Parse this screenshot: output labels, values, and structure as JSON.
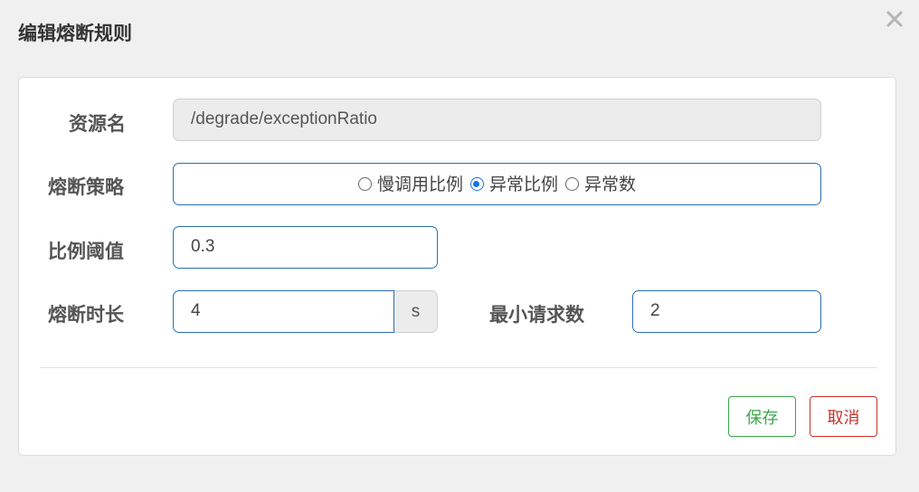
{
  "dialog": {
    "title": "编辑熔断规则"
  },
  "form": {
    "resource_label": "资源名",
    "resource_value": "/degrade/exceptionRatio",
    "strategy_label": "熔断策略",
    "strategy_options": [
      {
        "label": "慢调用比例",
        "checked": false
      },
      {
        "label": "异常比例",
        "checked": true
      },
      {
        "label": "异常数",
        "checked": false
      }
    ],
    "ratio_label": "比例阈值",
    "ratio_value": "0.3",
    "duration_label": "熔断时长",
    "duration_value": "4",
    "duration_unit": "s",
    "min_request_label": "最小请求数",
    "min_request_value": "2"
  },
  "actions": {
    "save_label": "保存",
    "cancel_label": "取消"
  },
  "colors": {
    "accent": "#1a73e8",
    "input_border": "#2b6fb5",
    "save": "#3aa64a",
    "cancel": "#c9302c"
  },
  "icons": {
    "close": "close-icon"
  }
}
